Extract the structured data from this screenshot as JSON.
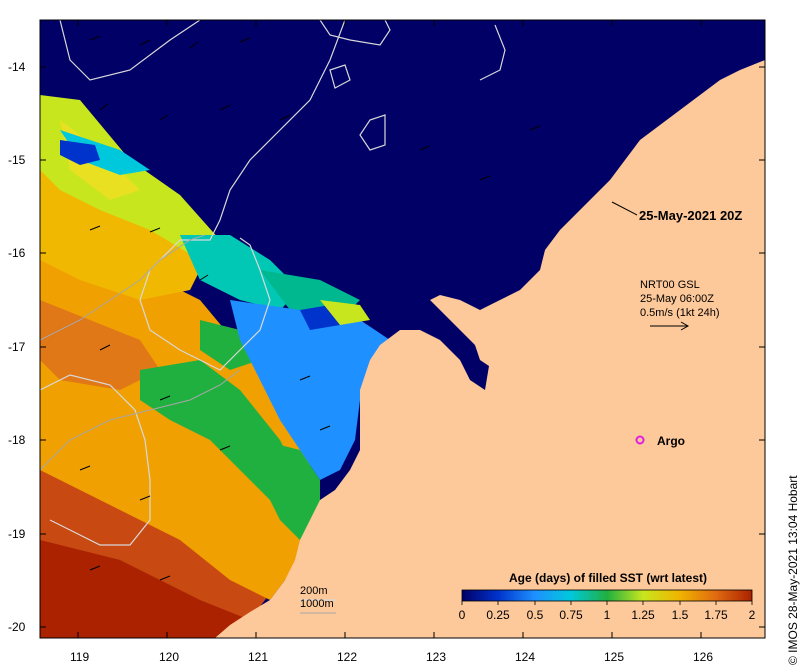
{
  "map": {
    "date_label": "25-May-2021 20Z",
    "current_info": [
      "NRT00 GSL",
      "25-May 06:00Z",
      "0.5m/s (1kt 24h)"
    ],
    "argo_label": "Argo",
    "contour_labels": [
      "200m",
      "1000m"
    ],
    "credit": "© IMOS 28-May-2021 13:04 Hobart",
    "x_ticks": [
      "119",
      "120",
      "121",
      "122",
      "123",
      "124",
      "125",
      "126"
    ],
    "y_ticks": [
      "-14",
      "-15",
      "-16",
      "-17",
      "-18",
      "-19",
      "-20"
    ],
    "colorbar": {
      "title": "Age (days) of filled SST (wrt latest)",
      "ticks": [
        "0",
        "0.25",
        "0.5",
        "0.75",
        "1",
        "1.25",
        "1.5",
        "1.75",
        "2"
      ],
      "colors": [
        "#000066",
        "#0033cc",
        "#1e90ff",
        "#00c8dc",
        "#20b040",
        "#c8e61e",
        "#f0b400",
        "#e06a10",
        "#aa2200"
      ]
    },
    "land_color": "#fdc89a",
    "sea_color": "#000066"
  }
}
